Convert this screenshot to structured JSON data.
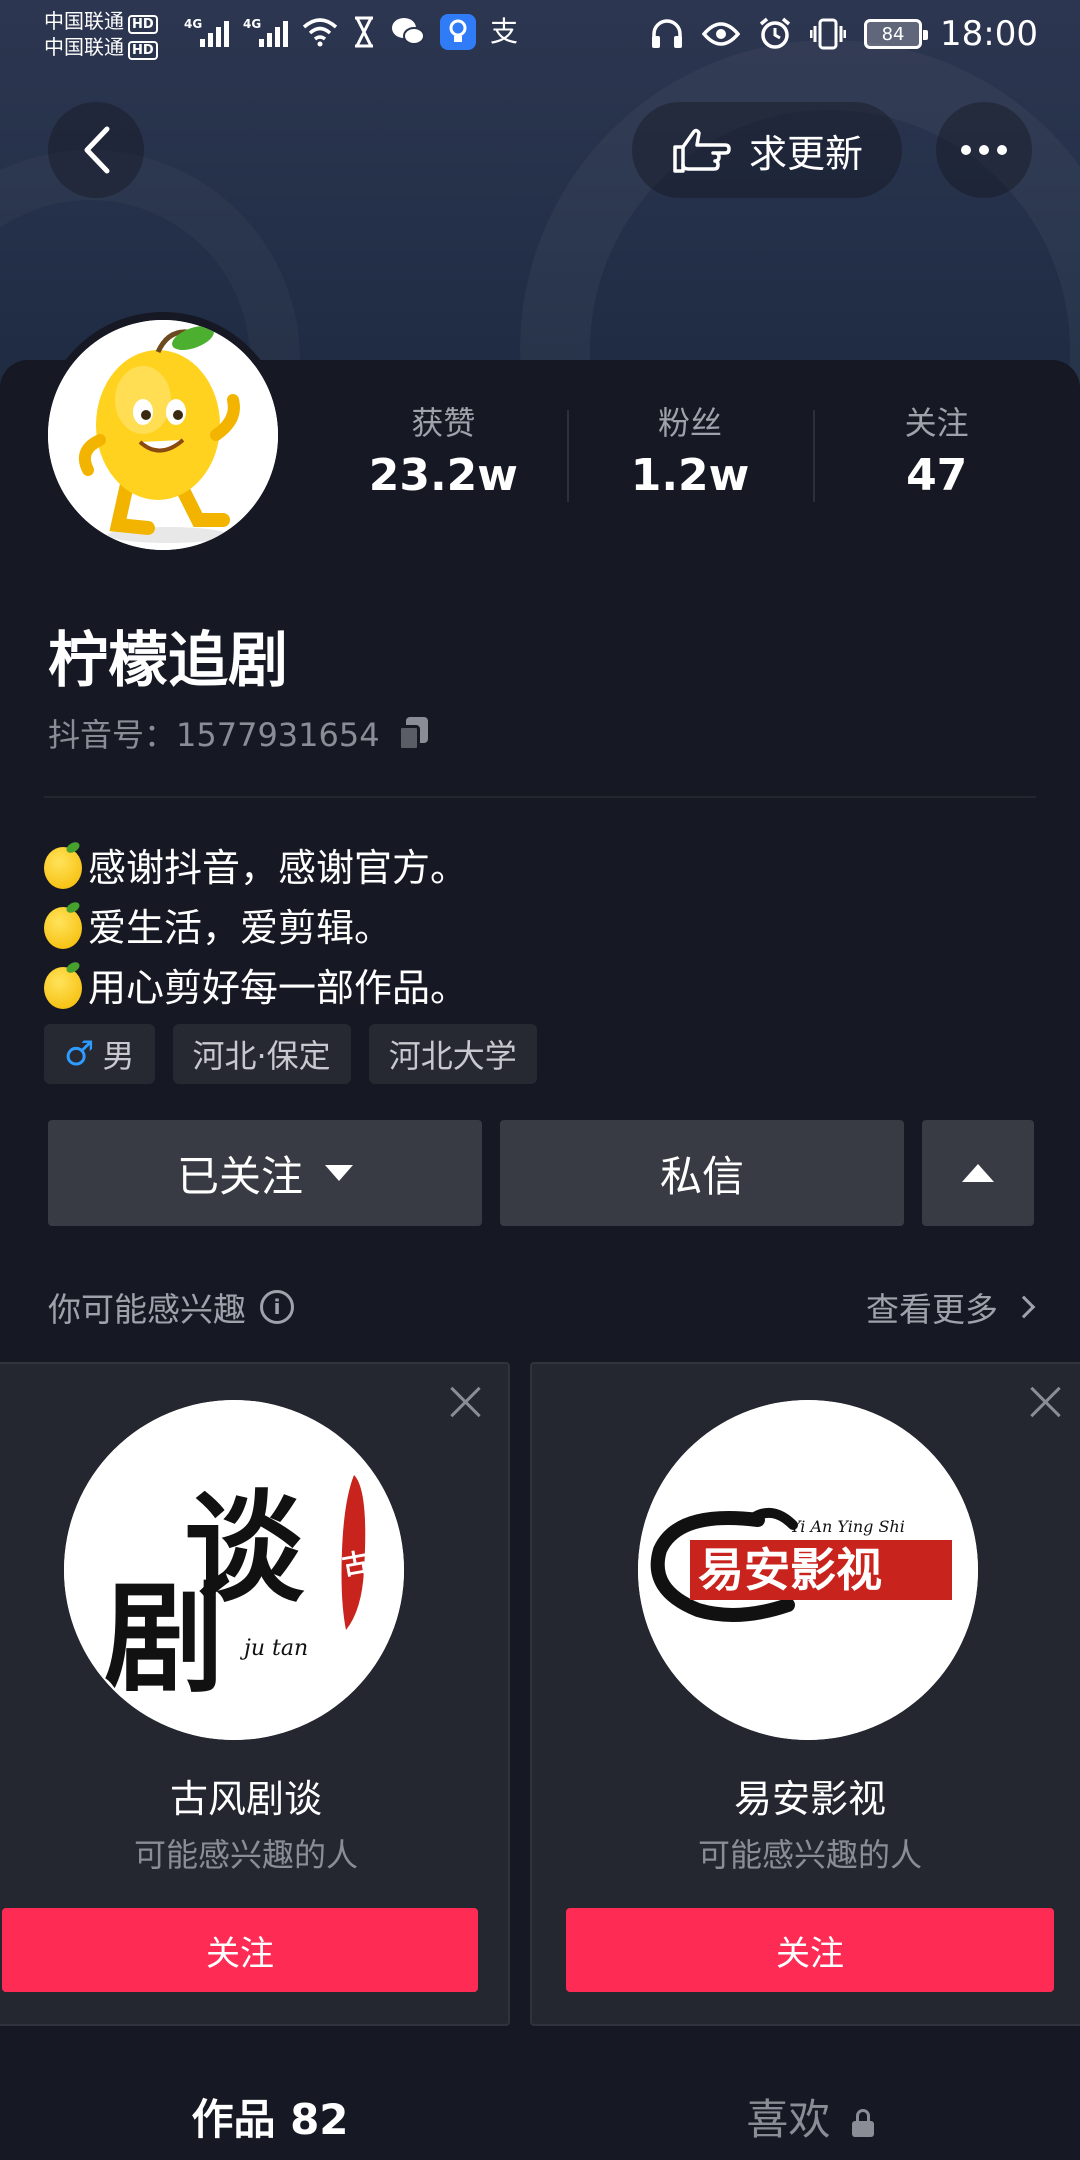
{
  "status_bar": {
    "carrier_1": "中国联通",
    "carrier_2": "中国联通",
    "hd": "HD",
    "network_1": "4G",
    "network_2": "4G",
    "alipay_glyph": "支",
    "battery": "84",
    "time": "18:00"
  },
  "header": {
    "request_update_label": "求更新"
  },
  "profile": {
    "nickname": "柠檬追剧",
    "douyin_id": "抖音号：1577931654",
    "stats": [
      {
        "label": "获赞",
        "value": "23.2w"
      },
      {
        "label": "粉丝",
        "value": "1.2w"
      },
      {
        "label": "关注",
        "value": "47"
      }
    ],
    "bio": [
      "感谢抖音，感谢官方。",
      "爱生活，爱剪辑。",
      "用心剪好每一部作品。"
    ],
    "tags": {
      "gender": "男",
      "location": "河北·保定",
      "school": "河北大学"
    }
  },
  "actions": {
    "followed_label": "已关注",
    "message_label": "私信"
  },
  "recommend": {
    "title": "你可能感兴趣",
    "more_label": "查看更多",
    "cards": [
      {
        "name": "古风剧谈",
        "subtitle": "可能感兴趣的人",
        "follow_label": "关注",
        "logo_text_1": "剧",
        "logo_text_2": "谈",
        "logo_seal": "古风",
        "logo_sub": "ju tan"
      },
      {
        "name": "易安影视",
        "subtitle": "可能感兴趣的人",
        "follow_label": "关注",
        "logo_text": "易安影视",
        "logo_sub": "Yi An Ying Shi"
      }
    ]
  },
  "tabs": {
    "works": "作品 82",
    "likes": "喜欢"
  },
  "colors": {
    "background": "#161823",
    "accent": "#fe2c55",
    "male": "#2e9bff"
  }
}
